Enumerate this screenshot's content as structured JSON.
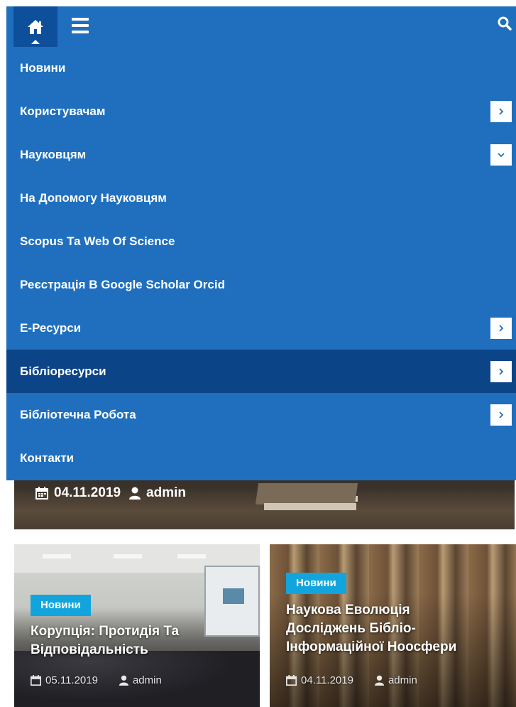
{
  "topbar": {
    "home_icon": "home-icon",
    "menu_icon": "hamburger-icon",
    "search_icon": "search-icon",
    "bar_color": "#1f6fbe",
    "home_bg_color": "#0e4f9b"
  },
  "menu": {
    "active_color": "#0b4487",
    "items": [
      {
        "label": "Новини",
        "submenu": null
      },
      {
        "label": "Користувачам",
        "submenu": "chevron-right-icon"
      },
      {
        "label": "Науковцям",
        "submenu": "chevron-down-icon"
      },
      {
        "label": "На Допомогу Науковцям",
        "submenu": null
      },
      {
        "label": "Scopus Та Web Of Science",
        "submenu": null
      },
      {
        "label": "Реєстрація В Google Scholar Orcid",
        "submenu": null
      },
      {
        "label": "Е-Ресурси",
        "submenu": "chevron-right-icon"
      },
      {
        "label": "Бібліоресурси",
        "submenu": "chevron-right-icon",
        "active": true
      },
      {
        "label": "Бібліотечна Робота",
        "submenu": "chevron-right-icon"
      },
      {
        "label": "Контакти",
        "submenu": null
      }
    ]
  },
  "hero": {
    "date": "04.11.2019",
    "author": "admin"
  },
  "cards": [
    {
      "category": "Новини",
      "title_line1": "Корупція: Протидія Та",
      "title_line2": "Відповідальність",
      "date": "05.11.2019",
      "author": "admin"
    },
    {
      "category": "Новини",
      "title_line1": "Наукова Еволюція",
      "title_line2": "Досліджень Бібліо-",
      "title_line3": "Інформаційної Ноосфери",
      "date": "04.11.2019",
      "author": "admin"
    }
  ],
  "badge_color": "#12a5dd"
}
